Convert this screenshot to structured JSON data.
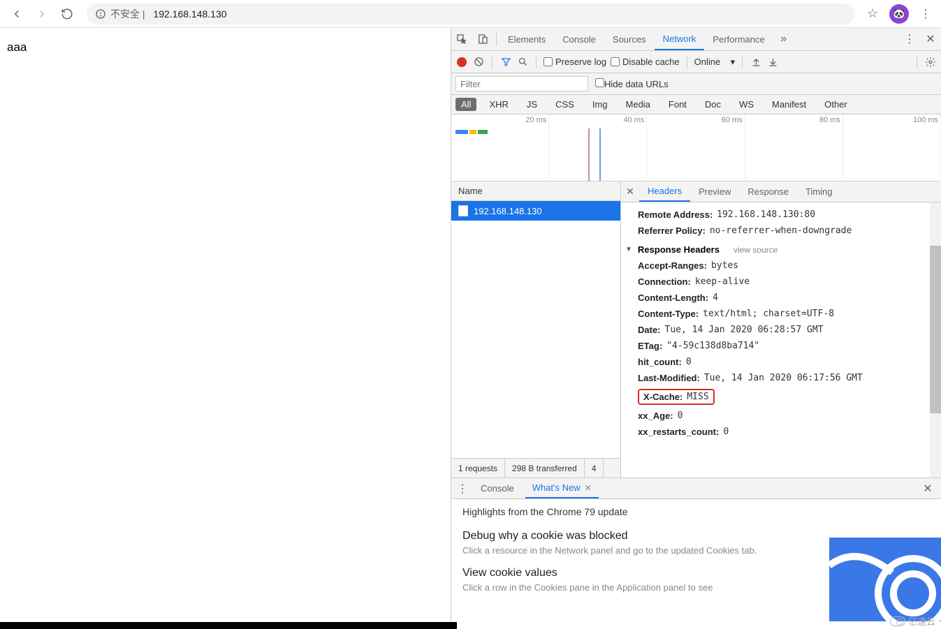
{
  "browser": {
    "insecure_label": "不安全",
    "url": "192.168.148.130",
    "avatar_emoji": "🐼"
  },
  "page": {
    "content": "aaa"
  },
  "devtools": {
    "tabs": [
      "Elements",
      "Console",
      "Sources",
      "Network",
      "Performance"
    ],
    "active_tab": "Network"
  },
  "network_toolbar": {
    "preserve_log": "Preserve log",
    "disable_cache": "Disable cache",
    "throttle": "Online"
  },
  "filter": {
    "placeholder": "Filter",
    "hide_data_urls": "Hide data URLs",
    "types": [
      "All",
      "XHR",
      "JS",
      "CSS",
      "Img",
      "Media",
      "Font",
      "Doc",
      "WS",
      "Manifest",
      "Other"
    ]
  },
  "timeline": {
    "ticks": [
      "20 ms",
      "40 ms",
      "60 ms",
      "80 ms",
      "100 ms"
    ]
  },
  "requests": {
    "header": "Name",
    "items": [
      "192.168.148.130"
    ],
    "status_requests": "1 requests",
    "status_transferred": "298 B transferred",
    "status_resources_trunc": "4"
  },
  "details": {
    "tabs": [
      "Headers",
      "Preview",
      "Response",
      "Timing"
    ],
    "general": [
      {
        "k": "Remote Address:",
        "v": "192.168.148.130:80"
      },
      {
        "k": "Referrer Policy:",
        "v": "no-referrer-when-downgrade"
      }
    ],
    "section_label": "Response Headers",
    "view_source": "view source",
    "response_headers": [
      {
        "k": "Accept-Ranges:",
        "v": "bytes"
      },
      {
        "k": "Connection:",
        "v": "keep-alive"
      },
      {
        "k": "Content-Length:",
        "v": "4"
      },
      {
        "k": "Content-Type:",
        "v": "text/html; charset=UTF-8"
      },
      {
        "k": "Date:",
        "v": "Tue, 14 Jan 2020 06:28:57 GMT"
      },
      {
        "k": "ETag:",
        "v": "\"4-59c138d8ba714\""
      },
      {
        "k": "hit_count:",
        "v": "0"
      },
      {
        "k": "Last-Modified:",
        "v": "Tue, 14 Jan 2020 06:17:56 GMT"
      },
      {
        "k": "X-Cache:",
        "v": "MISS",
        "highlight": true
      },
      {
        "k": "xx_Age:",
        "v": "0"
      },
      {
        "k": "xx_restarts_count:",
        "v": "0"
      }
    ]
  },
  "drawer": {
    "tabs": [
      {
        "label": "Console",
        "closable": false
      },
      {
        "label": "What's New",
        "closable": true
      }
    ],
    "highlights_title": "Highlights from the Chrome 79 update",
    "items": [
      {
        "title": "Debug why a cookie was blocked",
        "desc": "Click a resource in the Network panel and go to the updated Cookies tab."
      },
      {
        "title": "View cookie values",
        "desc": "Click a row in the Cookies pane in the Application panel to see"
      }
    ]
  },
  "watermark": "亿速云"
}
